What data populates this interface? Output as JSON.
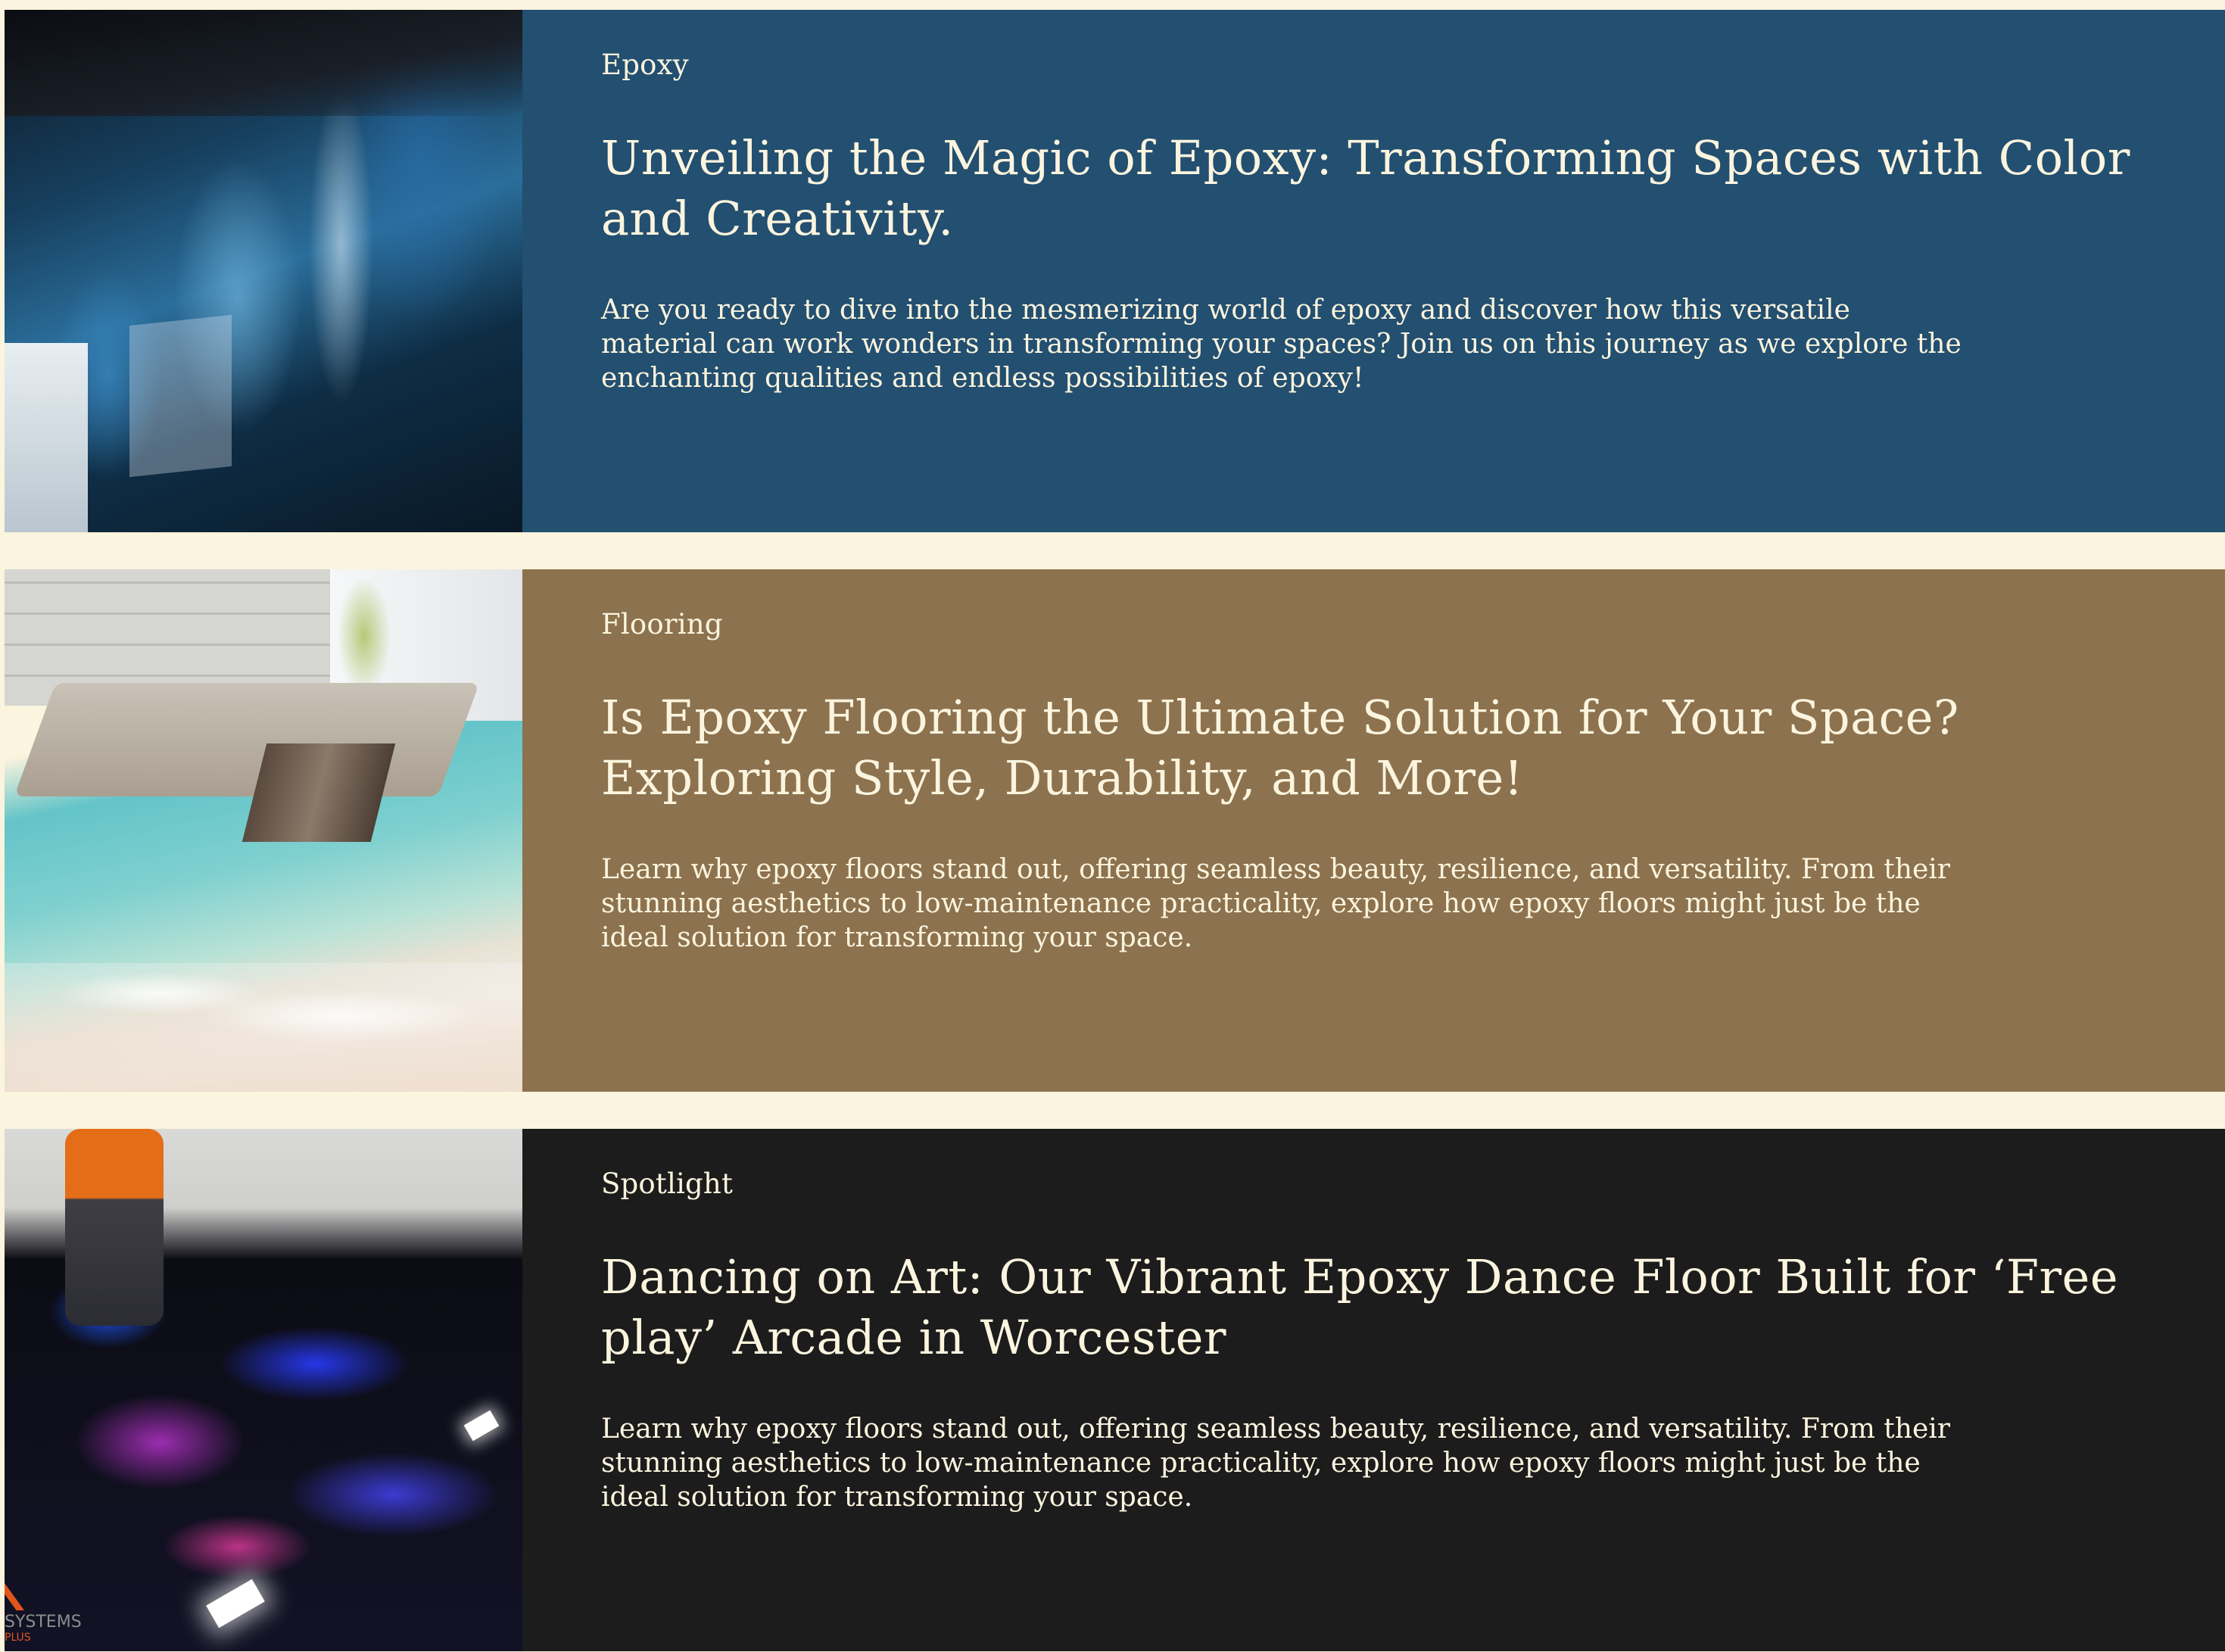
{
  "colors": {
    "page_background": "#fbf4de",
    "card_text": "#fbf4de"
  },
  "cards": [
    {
      "category": "Epoxy",
      "title": "Unveiling the Magic of Epoxy: Transforming Spaces with Color and Creativity.",
      "description": "Are you ready to dive into the mesmerizing world of epoxy and discover how this versatile material can work wonders in transforming your spaces? Join us on this journey as we explore the enchanting qualities and endless possibilities of epoxy!",
      "background": "#234f70"
    },
    {
      "category": "Flooring",
      "title": "Is Epoxy Flooring the Ultimate Solution for Your Space? Exploring Style, Durability, and More!",
      "description": "Learn why epoxy floors stand out, offering seamless beauty, resilience, and versatility. From their stunning aesthetics to low-maintenance practicality, explore how epoxy floors might just be the ideal solution for transforming your space.",
      "background": "#8c724e"
    },
    {
      "category": "Spotlight",
      "title": "Dancing on Art: Our Vibrant Epoxy Dance Floor Built for ‘Free play’ Arcade in Worcester",
      "description": "Learn why epoxy floors stand out, offering seamless beauty, resilience, and versatility. From their stunning aesthetics to low-maintenance practicality, explore how epoxy floors might just be the ideal solution for transforming your space.",
      "background": "#1c1c1c",
      "image_logo_text": "SYSTEMS",
      "image_logo_subtext": "PLUS"
    }
  ]
}
